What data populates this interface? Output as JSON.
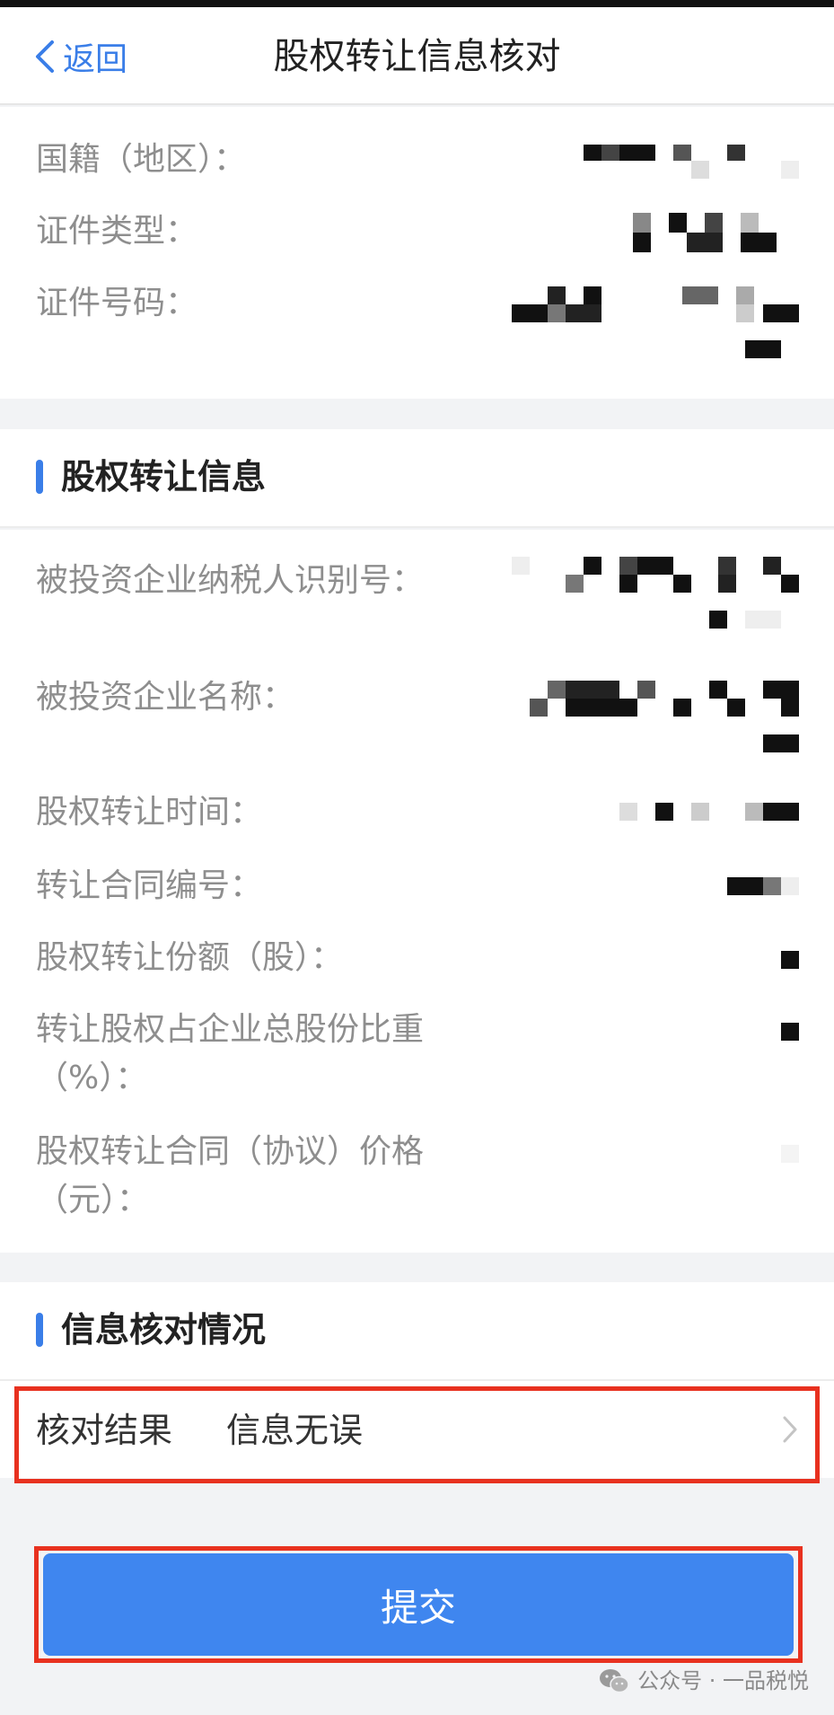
{
  "nav": {
    "back_label": "返回",
    "title": "股权转让信息核对"
  },
  "person": {
    "nationality_label": "国籍（地区）：",
    "id_type_label": "证件类型：",
    "id_number_label": "证件号码："
  },
  "transfer_section": {
    "heading": "股权转让信息",
    "taxpayer_id_label": "被投资企业纳税人识别号：",
    "company_name_label": "被投资企业名称：",
    "transfer_time_label": "股权转让时间：",
    "contract_no_label": "转让合同编号：",
    "shares_label": "股权转让份额（股）：",
    "ratio_label_line1": "转让股权占企业总股份比重",
    "ratio_label_line2": "（%）：",
    "price_label_line1": "股权转让合同（协议）价格",
    "price_label_line2": "（元）："
  },
  "verify_section": {
    "heading": "信息核对情况",
    "result_label": "核对结果",
    "result_value": "信息无误"
  },
  "submit_label": "提交",
  "watermark": "公众号 · 一品税悦",
  "colors": {
    "accent": "#3a7ee8",
    "button": "#3f86ef",
    "highlight_frame": "#e8311f"
  }
}
